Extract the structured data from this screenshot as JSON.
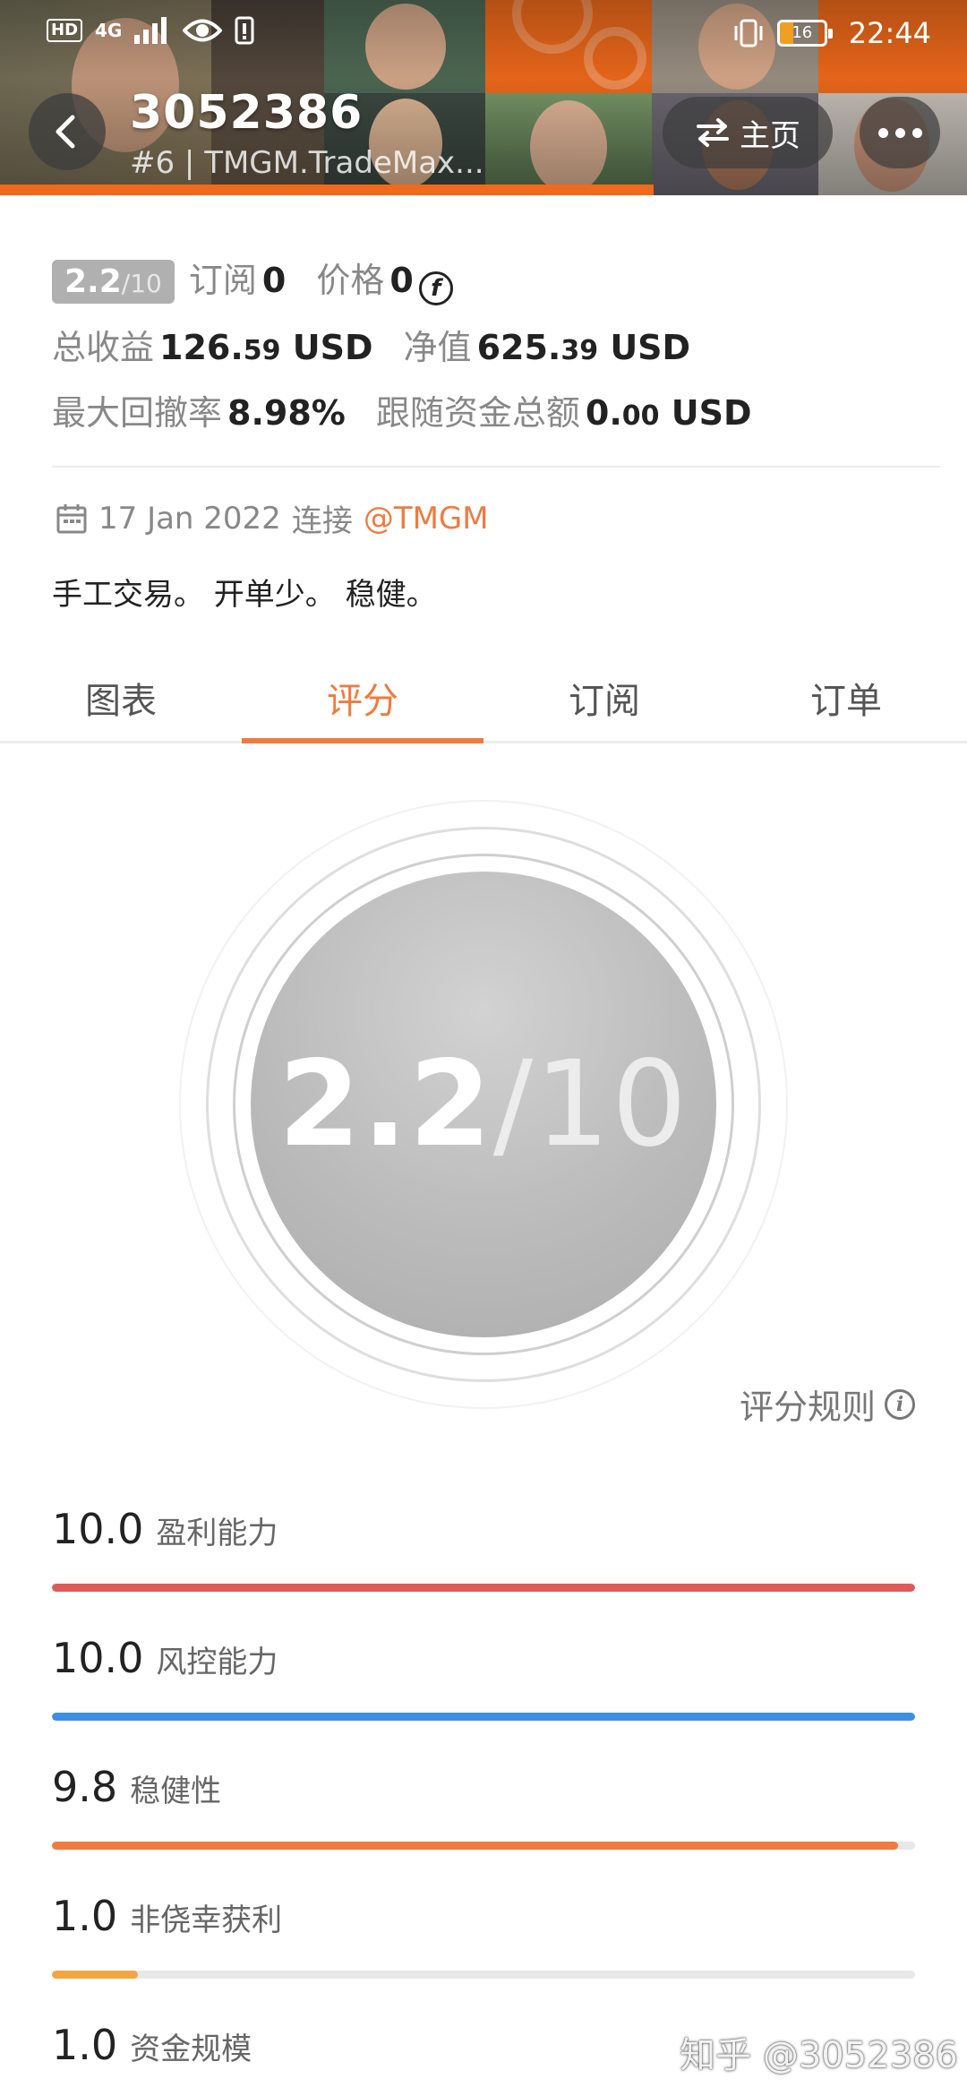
{
  "status_bar": {
    "hd": "HD",
    "network": "4G",
    "battery": "16",
    "time": "22:44"
  },
  "header": {
    "account_id": "3052386",
    "subtitle": "#6 | TMGM.TradeMax...",
    "home_label": "主页"
  },
  "summary": {
    "score": "2.2",
    "score_den": "/10",
    "subscribe_label": "订阅",
    "subscribe_value": "0",
    "price_label": "价格",
    "price_value": "0",
    "total_profit_label": "总收益",
    "total_profit_int": "126.",
    "total_profit_dec": "59",
    "total_profit_unit": "USD",
    "net_value_label": "净值",
    "net_value_int": "625.",
    "net_value_dec": "39",
    "net_value_unit": "USD",
    "max_drawdown_label": "最大回撤率",
    "max_drawdown_value": "8.98%",
    "follow_funds_label": "跟随资金总额",
    "follow_funds_int": "0.",
    "follow_funds_dec": "00",
    "follow_funds_unit": "USD"
  },
  "connection": {
    "date": "17 Jan 2022",
    "connect_label": "连接",
    "broker": "@TMGM"
  },
  "description": "手工交易。 开单少。 稳健。",
  "tabs": [
    {
      "label": "图表",
      "active": false
    },
    {
      "label": "评分",
      "active": true
    },
    {
      "label": "订阅",
      "active": false
    },
    {
      "label": "订单",
      "active": false
    }
  ],
  "gauge": {
    "score": "2.2",
    "den": "/10"
  },
  "rules_label": "评分规则",
  "metrics": [
    {
      "score": "10.0",
      "name": "盈利能力",
      "value": 10.0,
      "max": 10,
      "color": "#e05a5a"
    },
    {
      "score": "10.0",
      "name": "风控能力",
      "value": 10.0,
      "max": 10,
      "color": "#3d8fe0"
    },
    {
      "score": "9.8",
      "name": "稳健性",
      "value": 9.8,
      "max": 10,
      "color": "#f07b3f"
    },
    {
      "score": "1.0",
      "name": "非侥幸获利",
      "value": 1.0,
      "max": 10,
      "color": "#f2a640"
    },
    {
      "score": "1.0",
      "name": "资金规模",
      "value": 1.0,
      "max": 10,
      "color": "#2bb39a"
    }
  ],
  "watermark": "知乎 @3052386",
  "colors": {
    "accent": "#f07b3f",
    "brand_orange": "#f06a1b"
  }
}
